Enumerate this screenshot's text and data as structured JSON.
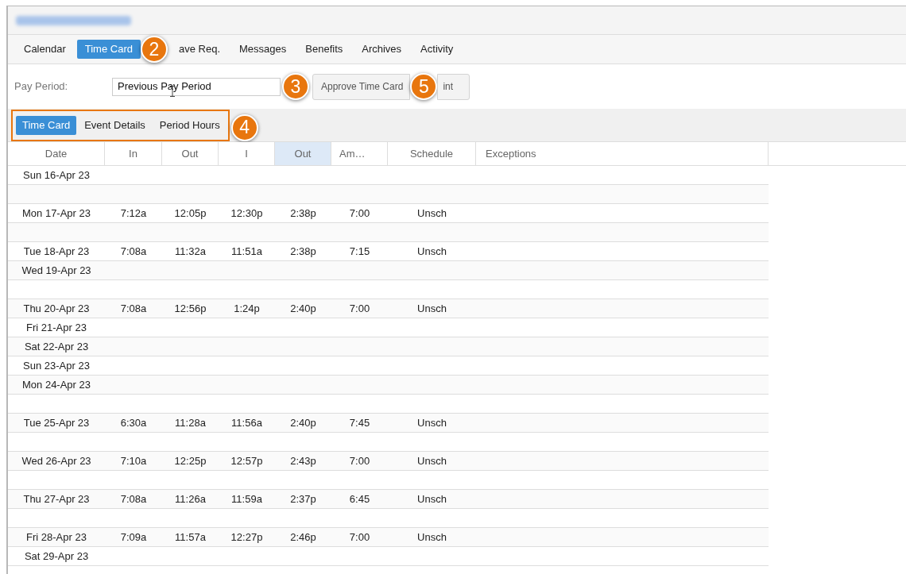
{
  "nav_tabs": [
    {
      "label": "Calendar",
      "selected": false
    },
    {
      "label": "Time Card",
      "selected": true
    },
    {
      "label": "ave Req.",
      "selected": false
    },
    {
      "label": "Messages",
      "selected": false
    },
    {
      "label": "Benefits",
      "selected": false
    },
    {
      "label": "Archives",
      "selected": false
    },
    {
      "label": "Activity",
      "selected": false
    }
  ],
  "pay_period": {
    "label": "Pay Period:",
    "value": "Previous Pay Period"
  },
  "buttons": [
    "Approve Time Card",
    "int"
  ],
  "sub_tabs": [
    {
      "label": "Time Card",
      "selected": true
    },
    {
      "label": "Event Details",
      "selected": false
    },
    {
      "label": "Period Hours",
      "selected": false
    }
  ],
  "table": {
    "columns": [
      {
        "label": "Date",
        "selected": false
      },
      {
        "label": "In",
        "selected": false
      },
      {
        "label": "Out",
        "selected": false
      },
      {
        "label": "I",
        "selected": false
      },
      {
        "label": "Out",
        "selected": true
      },
      {
        "label": "Am…",
        "selected": false
      },
      {
        "label": "Schedule",
        "selected": false
      },
      {
        "label": "Exceptions",
        "selected": false
      }
    ],
    "rows": [
      {
        "kind": "day",
        "cells": [
          "Sun 16-Apr 23"
        ]
      },
      {
        "kind": "blank"
      },
      {
        "kind": "day",
        "cells": [
          "Mon 17-Apr 23",
          "7:12a",
          "12:05p",
          "12:30p",
          "2:38p",
          "7:00",
          "Unsch"
        ]
      },
      {
        "kind": "blank"
      },
      {
        "kind": "day",
        "cells": [
          "Tue 18-Apr 23",
          "7:08a",
          "11:32a",
          "11:51a",
          "2:38p",
          "7:15",
          "Unsch"
        ]
      },
      {
        "kind": "day",
        "cells": [
          "Wed 19-Apr 23"
        ]
      },
      {
        "kind": "blank"
      },
      {
        "kind": "day",
        "cells": [
          "Thu 20-Apr 23",
          "7:08a",
          "12:56p",
          "1:24p",
          "2:40p",
          "7:00",
          "Unsch"
        ]
      },
      {
        "kind": "day",
        "cells": [
          "Fri 21-Apr 23"
        ]
      },
      {
        "kind": "day",
        "cells": [
          "Sat 22-Apr 23"
        ]
      },
      {
        "kind": "day",
        "cells": [
          "Sun 23-Apr 23"
        ]
      },
      {
        "kind": "day",
        "cells": [
          "Mon 24-Apr 23"
        ]
      },
      {
        "kind": "blank"
      },
      {
        "kind": "day",
        "cells": [
          "Tue 25-Apr 23",
          "6:30a",
          "11:28a",
          "11:56a",
          "2:40p",
          "7:45",
          "Unsch"
        ]
      },
      {
        "kind": "blank"
      },
      {
        "kind": "day",
        "cells": [
          "Wed 26-Apr 23",
          "7:10a",
          "12:25p",
          "12:57p",
          "2:43p",
          "7:00",
          "Unsch"
        ]
      },
      {
        "kind": "blank"
      },
      {
        "kind": "day",
        "cells": [
          "Thu 27-Apr 23",
          "7:08a",
          "11:26a",
          "11:59a",
          "2:37p",
          "6:45",
          "Unsch"
        ]
      },
      {
        "kind": "blank"
      },
      {
        "kind": "day",
        "cells": [
          "Fri 28-Apr 23",
          "7:09a",
          "11:57a",
          "12:27p",
          "2:46p",
          "7:00",
          "Unsch"
        ]
      },
      {
        "kind": "day",
        "cells": [
          "Sat 29-Apr 23"
        ]
      }
    ]
  },
  "callouts": [
    {
      "label": "2"
    },
    {
      "label": "3"
    },
    {
      "label": "4"
    },
    {
      "label": "5"
    }
  ]
}
